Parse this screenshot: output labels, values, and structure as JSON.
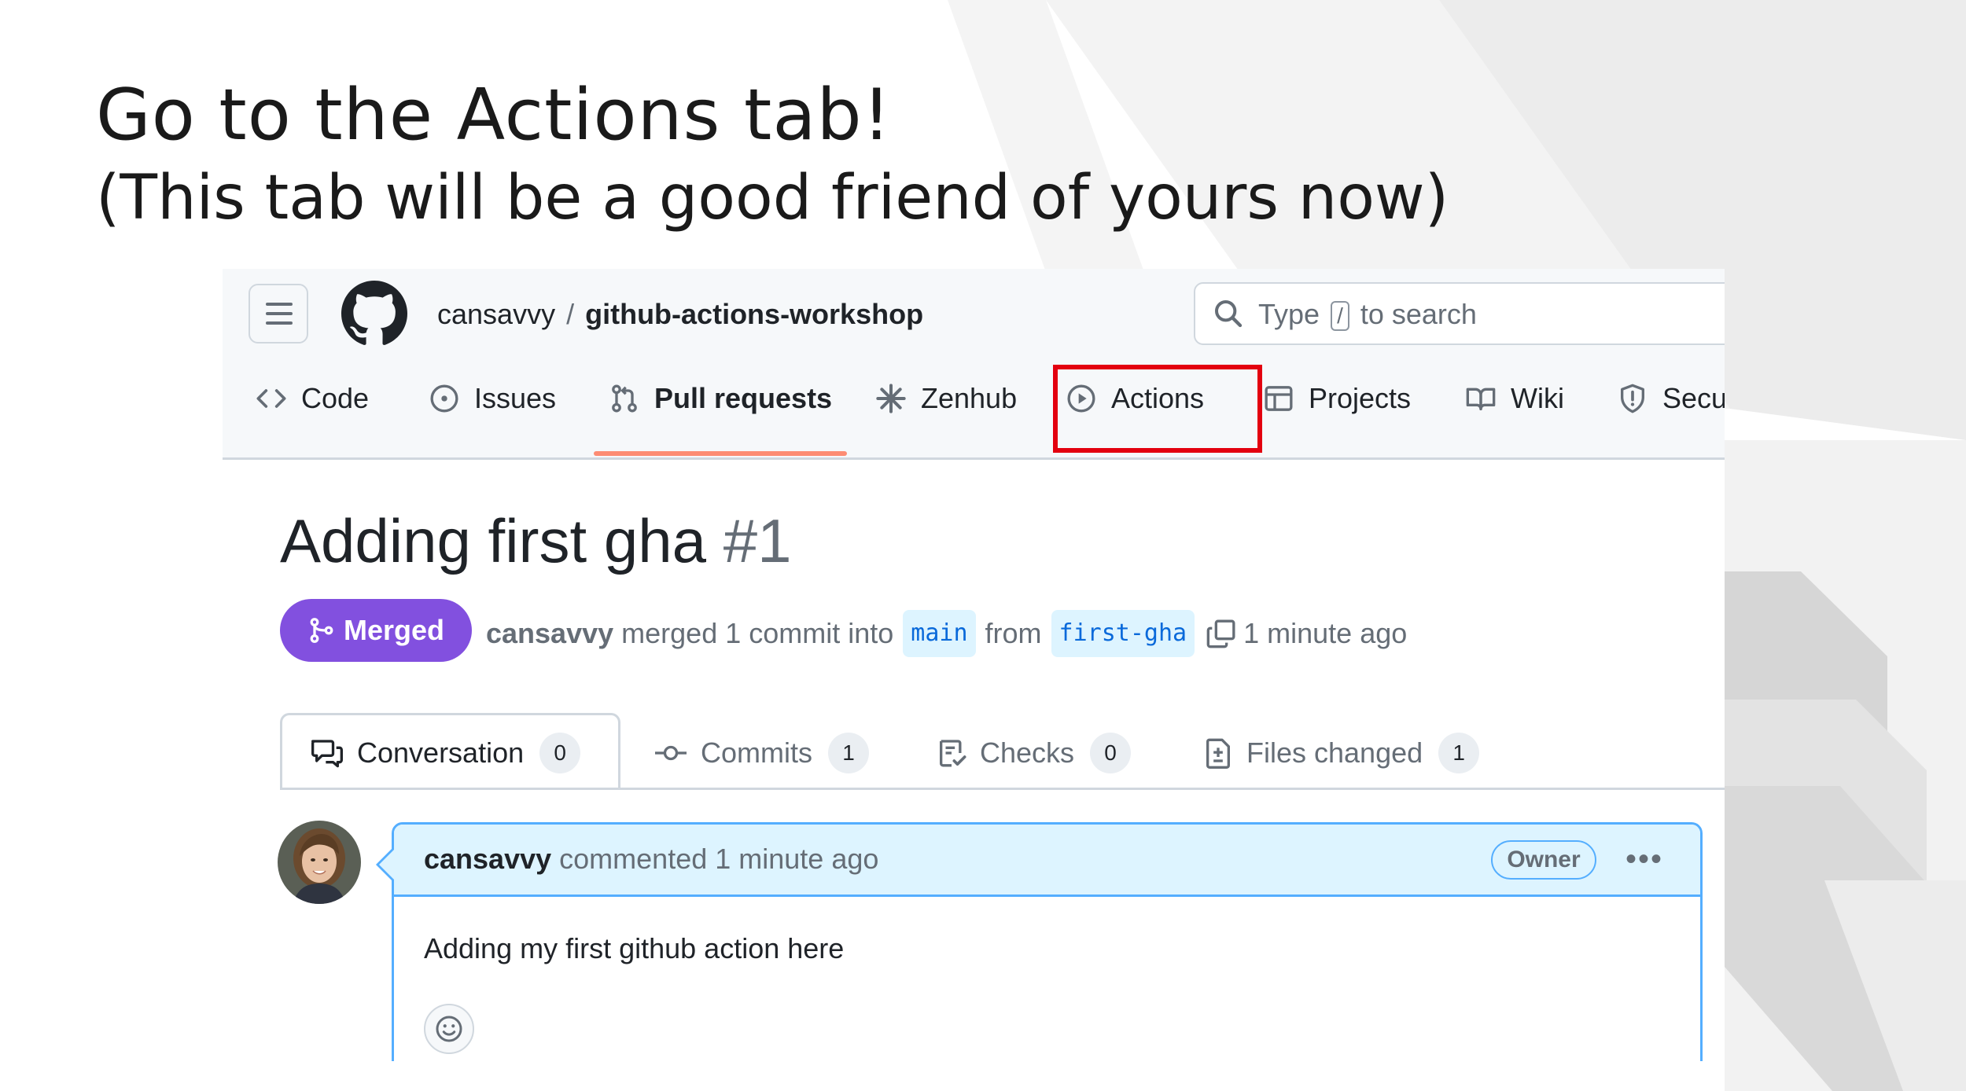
{
  "slide": {
    "title": "Go to the Actions tab!",
    "subtitle": "(This tab will be a good friend of yours now)"
  },
  "header": {
    "owner": "cansavvy",
    "separator": "/",
    "repo": "github-actions-workshop",
    "search": {
      "prefix": "Type",
      "key": "/",
      "suffix": "to search"
    }
  },
  "repo_tabs": [
    {
      "label": "Code",
      "icon": "code-icon"
    },
    {
      "label": "Issues",
      "icon": "issue-icon"
    },
    {
      "label": "Pull requests",
      "icon": "pull-request-icon",
      "active": true
    },
    {
      "label": "Zenhub",
      "icon": "zenhub-icon"
    },
    {
      "label": "Actions",
      "icon": "play-icon",
      "highlighted": true
    },
    {
      "label": "Projects",
      "icon": "table-icon"
    },
    {
      "label": "Wiki",
      "icon": "book-icon"
    },
    {
      "label": "Secu",
      "icon": "shield-icon"
    }
  ],
  "pr": {
    "title": "Adding first gha",
    "number": "#1",
    "state": "Merged",
    "author": "cansavvy",
    "merged_text": "merged 1 commit into",
    "base_branch": "main",
    "from_text": "from",
    "head_branch": "first-gha",
    "time": "1 minute ago"
  },
  "pr_tabs": [
    {
      "label": "Conversation",
      "count": "0",
      "icon": "comment-discussion-icon"
    },
    {
      "label": "Commits",
      "count": "1",
      "icon": "commit-icon"
    },
    {
      "label": "Checks",
      "count": "0",
      "icon": "checklist-icon"
    },
    {
      "label": "Files changed",
      "count": "1",
      "icon": "file-diff-icon"
    }
  ],
  "comment": {
    "author": "cansavvy",
    "action": "commented 1 minute ago",
    "badge": "Owner",
    "more": "•••",
    "body": "Adding my first github action here"
  },
  "colors": {
    "merged": "#8250df",
    "highlight_box": "#e3000f",
    "active_underline": "#fd8c73",
    "branch_text": "#0969da",
    "comment_border": "#54aeff"
  }
}
